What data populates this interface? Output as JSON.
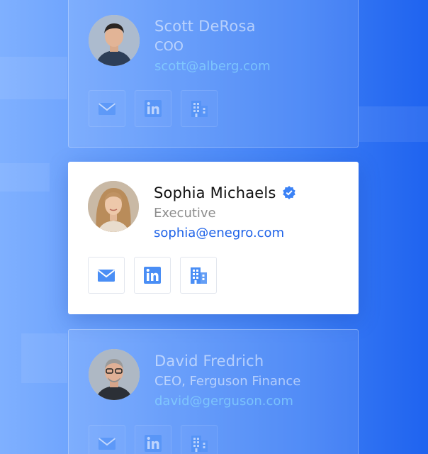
{
  "contacts": [
    {
      "name": "Scott DeRosa",
      "title": "COO",
      "email": "scott@alberg.com",
      "state": "faded",
      "verified": false
    },
    {
      "name": "Sophia Michaels",
      "title": "Executive",
      "email": "sophia@enegro.com",
      "state": "active",
      "verified": true
    },
    {
      "name": "David Fredrich",
      "title": "CEO, Ferguson Finance",
      "email": "david@gerguson.com",
      "state": "faded",
      "verified": false
    }
  ],
  "actions": [
    "email-icon",
    "linkedin-icon",
    "building-icon"
  ],
  "colors": {
    "accent": "#1f63e8",
    "icon": "#4a8ef5",
    "verified": "#3b82f6"
  }
}
